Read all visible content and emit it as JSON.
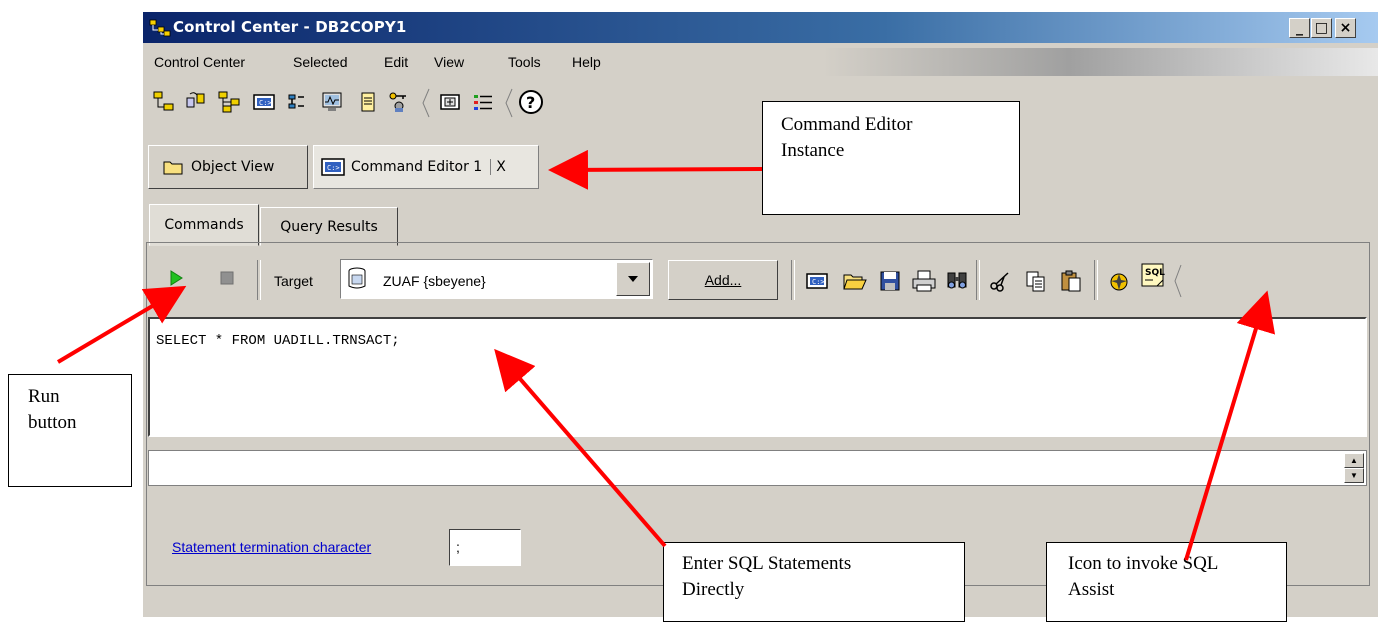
{
  "window": {
    "title": "Control Center - DB2COPY1",
    "controls": {
      "minimize": "_",
      "maximize": "□",
      "close": "×"
    }
  },
  "menu": {
    "items": [
      "Control Center",
      "Selected",
      "Edit",
      "View",
      "Tools",
      "Help"
    ]
  },
  "main_toolbar": {
    "icons": [
      "object-tree-icon",
      "replication-icon",
      "satellite-icon",
      "command-editor-icon",
      "task-center-icon",
      "health-center-icon",
      "journal-icon",
      "license-center-icon",
      "window-icon",
      "list-icon",
      "help-icon"
    ]
  },
  "view_tabs": {
    "object_view": "Object View",
    "command_editor": "Command Editor 1",
    "close": "X"
  },
  "inner_tabs": {
    "commands": "Commands",
    "query_results": "Query Results"
  },
  "command_toolbar": {
    "target_label": "Target",
    "target_value": "ZUAF {sbeyene}",
    "add_button": "Add...",
    "sql_label": "SQL"
  },
  "editor": {
    "text": "SELECT * FROM UADILL.TRNSACT;"
  },
  "termination": {
    "label": "Statement termination character",
    "value": ";"
  },
  "annotations": {
    "command_editor_instance": [
      "Command Editor",
      "Instance"
    ],
    "run_button": [
      "Run",
      "button"
    ],
    "enter_sql": [
      "Enter SQL Statements",
      "Directly"
    ],
    "sql_assist": [
      "Icon to invoke SQL",
      "Assist"
    ]
  },
  "colors": {
    "arrow": "#ff0000",
    "title_start": "#0a246a",
    "link": "#0000cc"
  }
}
